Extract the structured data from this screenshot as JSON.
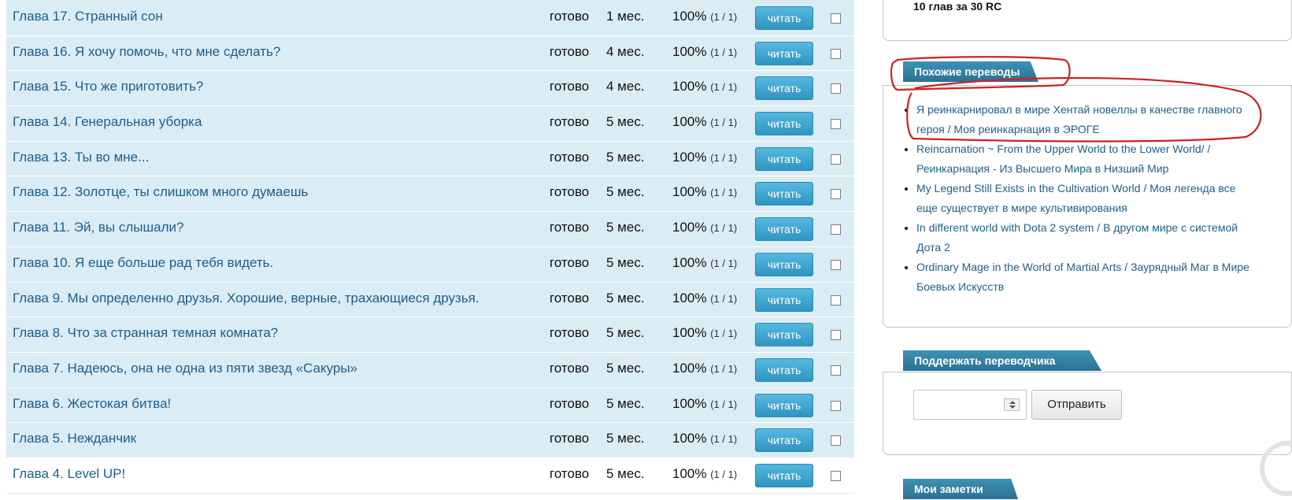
{
  "chapters": [
    {
      "title": "Глава 17. Странный сон",
      "status": "готово",
      "age": "1 мес.",
      "percent": "100%",
      "pages": "(1 / 1)",
      "button": "читать"
    },
    {
      "title": "Глава 16. Я хочу помочь, что мне сделать?",
      "status": "готово",
      "age": "4 мес.",
      "percent": "100%",
      "pages": "(1 / 1)",
      "button": "читать"
    },
    {
      "title": "Глава 15. Что же приготовить?",
      "status": "готово",
      "age": "4 мес.",
      "percent": "100%",
      "pages": "(1 / 1)",
      "button": "читать"
    },
    {
      "title": "Глава 14. Генеральная уборка",
      "status": "готово",
      "age": "5 мес.",
      "percent": "100%",
      "pages": "(1 / 1)",
      "button": "читать"
    },
    {
      "title": "Глава 13. Ты во мне...",
      "status": "готово",
      "age": "5 мес.",
      "percent": "100%",
      "pages": "(1 / 1)",
      "button": "читать"
    },
    {
      "title": "Глава 12. Золотце, ты слишком много думаешь",
      "status": "готово",
      "age": "5 мес.",
      "percent": "100%",
      "pages": "(1 / 1)",
      "button": "читать"
    },
    {
      "title": "Глава 11. Эй, вы слышали?",
      "status": "готово",
      "age": "5 мес.",
      "percent": "100%",
      "pages": "(1 / 1)",
      "button": "читать"
    },
    {
      "title": "Глава 10. Я еще больше рад тебя видеть.",
      "status": "готово",
      "age": "5 мес.",
      "percent": "100%",
      "pages": "(1 / 1)",
      "button": "читать"
    },
    {
      "title": "Глава 9. Мы определенно друзья. Хорошие, верные, трахающиеся друзья.",
      "status": "готово",
      "age": "5 мес.",
      "percent": "100%",
      "pages": "(1 / 1)",
      "button": "читать"
    },
    {
      "title": "Глава 8. Что за странная темная комната?",
      "status": "готово",
      "age": "5 мес.",
      "percent": "100%",
      "pages": "(1 / 1)",
      "button": "читать"
    },
    {
      "title": "Глава 7. Надеюсь, она не одна из пяти звезд «Сакуры»",
      "status": "готово",
      "age": "5 мес.",
      "percent": "100%",
      "pages": "(1 / 1)",
      "button": "читать"
    },
    {
      "title": "Глава 6. Жестокая битва!",
      "status": "готово",
      "age": "5 мес.",
      "percent": "100%",
      "pages": "(1 / 1)",
      "button": "читать"
    },
    {
      "title": "Глава 5. Нежданчик",
      "status": "готово",
      "age": "5 мес.",
      "percent": "100%",
      "pages": "(1 / 1)",
      "button": "читать"
    },
    {
      "title": "Глава 4. Level UP!",
      "status": "готово",
      "age": "5 мес.",
      "percent": "100%",
      "pages": "(1 / 1)",
      "button": "читать"
    }
  ],
  "sidebar": {
    "bonus_text": "10 глав за 30 RC",
    "similar": {
      "header": "Похожие переводы",
      "items": [
        "Я реинкарнировал в мире Хентай новеллы в качестве главного героя / Моя реинкарнация в ЭРОГЕ",
        "Reincarnation ~ From the Upper World to the Lower World/ / Реинкарнация - Из Высшего Мира в Низший Мир",
        "My Legend Still Exists in the Cultivation World / Моя легенда все еще существует в мире культивирования",
        "In different world with Dota 2 system / В другом мире с системой Дота 2",
        "Ordinary Mage in the World of Martial Arts / Заурядный Маг в Мире Боевых Искусств"
      ]
    },
    "support": {
      "header": "Поддержать переводчика",
      "input_value": "",
      "send_label": "Отправить"
    },
    "notes": {
      "header": "Мои заметки"
    }
  },
  "colors": {
    "row_bg": "#daecf4",
    "link": "#1d5f8a",
    "button": "#3aa3cc",
    "header": "#2f7ea2",
    "annotation": "#cc2222"
  }
}
